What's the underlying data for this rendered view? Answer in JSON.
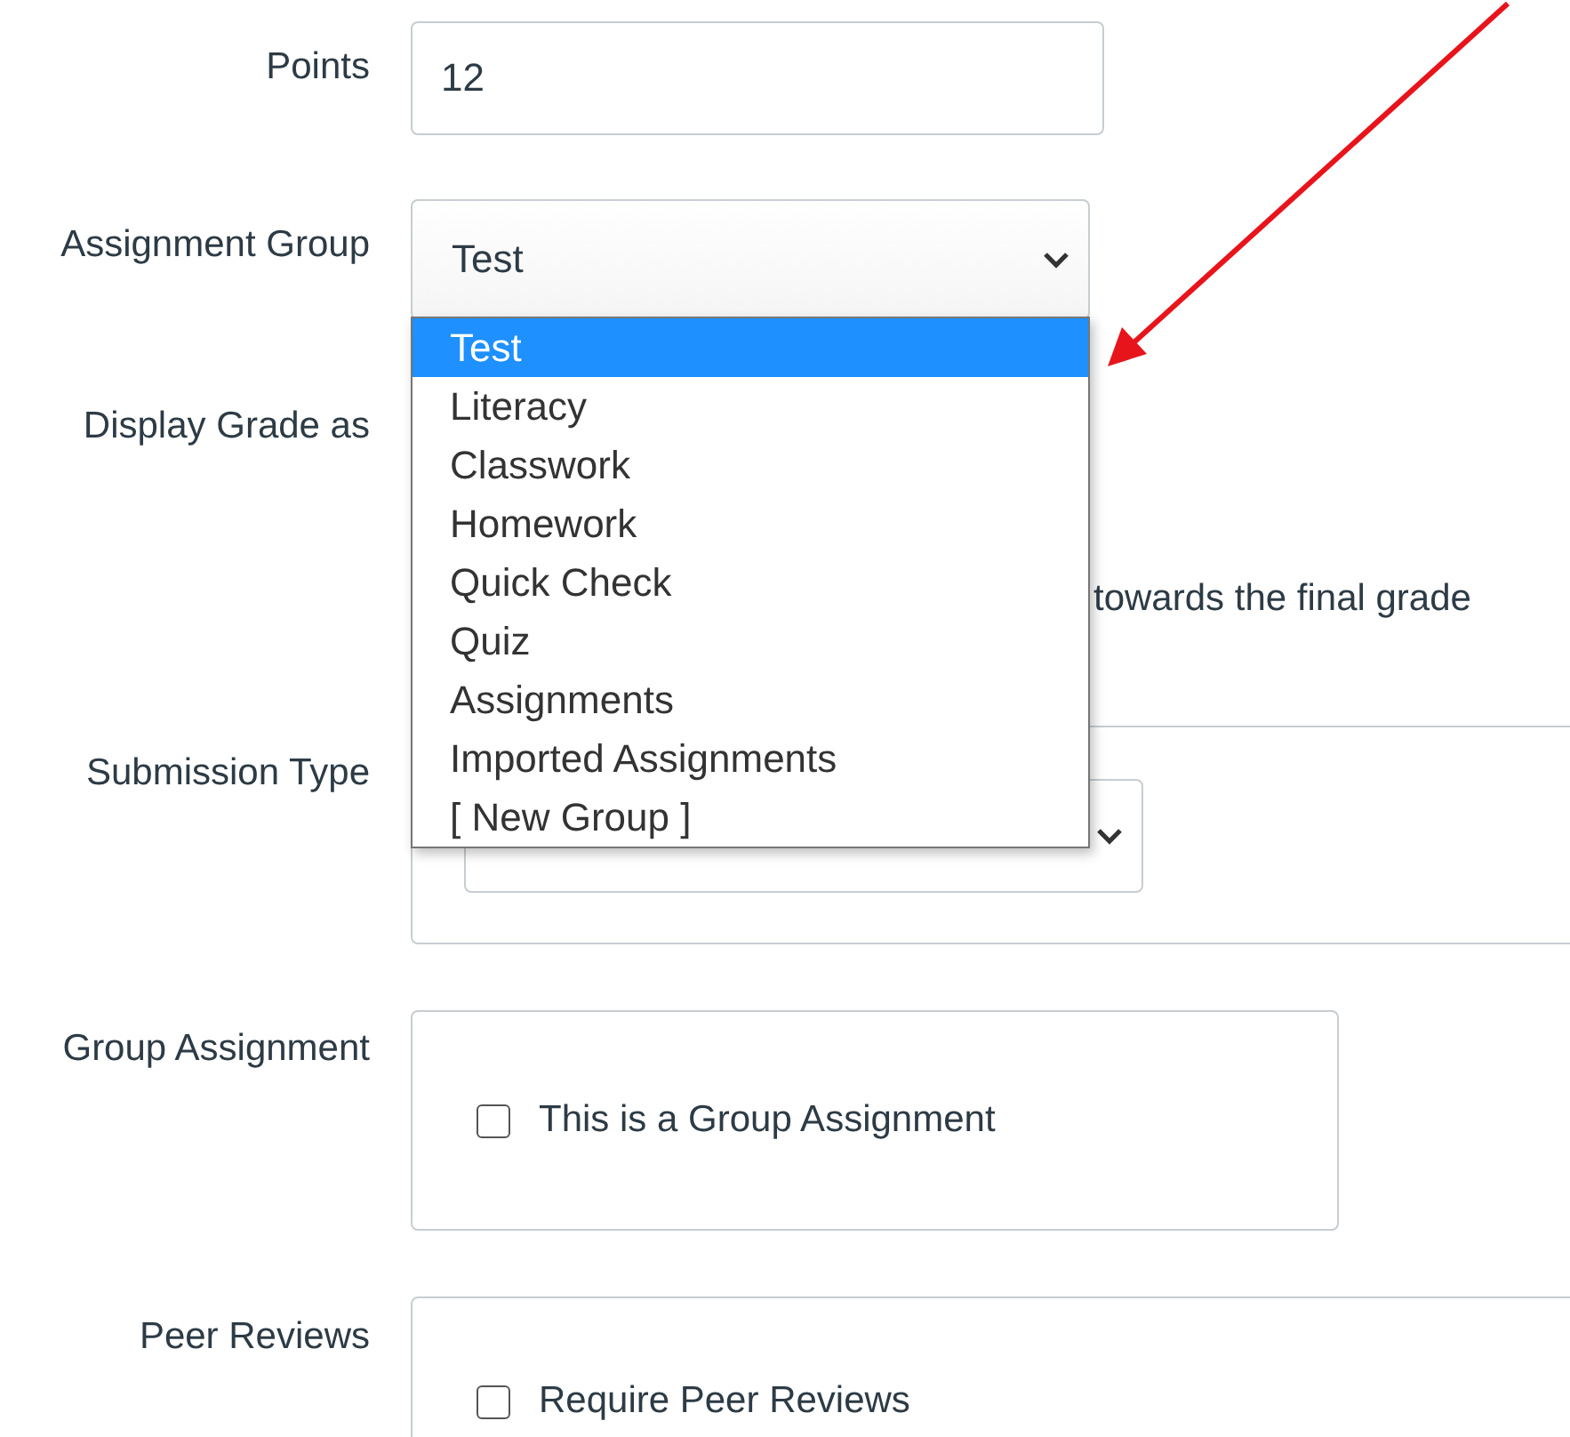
{
  "fields": [
    {
      "kind": "text_input",
      "label": "Points",
      "value": "12"
    },
    {
      "kind": "select",
      "label": "Assignment Group",
      "value": "Test",
      "open": true,
      "options": [
        {
          "label": "Test",
          "selected": true
        },
        {
          "label": "Literacy",
          "selected": false
        },
        {
          "label": "Classwork",
          "selected": false
        },
        {
          "label": "Homework",
          "selected": false
        },
        {
          "label": "Quick Check",
          "selected": false
        },
        {
          "label": "Quiz",
          "selected": false
        },
        {
          "label": "Assignments",
          "selected": false
        },
        {
          "label": "Imported Assignments",
          "selected": false
        },
        {
          "label": "[ New Group ]",
          "selected": false
        }
      ]
    },
    {
      "kind": "covered",
      "label": "Display Grade as",
      "visible_text": "towards the final grade"
    },
    {
      "kind": "panel_select",
      "label": "Submission Type"
    },
    {
      "kind": "checkbox_panel",
      "label": "Group Assignment",
      "checkbox": {
        "label": "This is a Group Assignment",
        "checked": false
      }
    },
    {
      "kind": "checkbox_panel",
      "label": "Peer Reviews",
      "checkbox": {
        "label": "Require Peer Reviews",
        "checked": false
      }
    }
  ]
}
